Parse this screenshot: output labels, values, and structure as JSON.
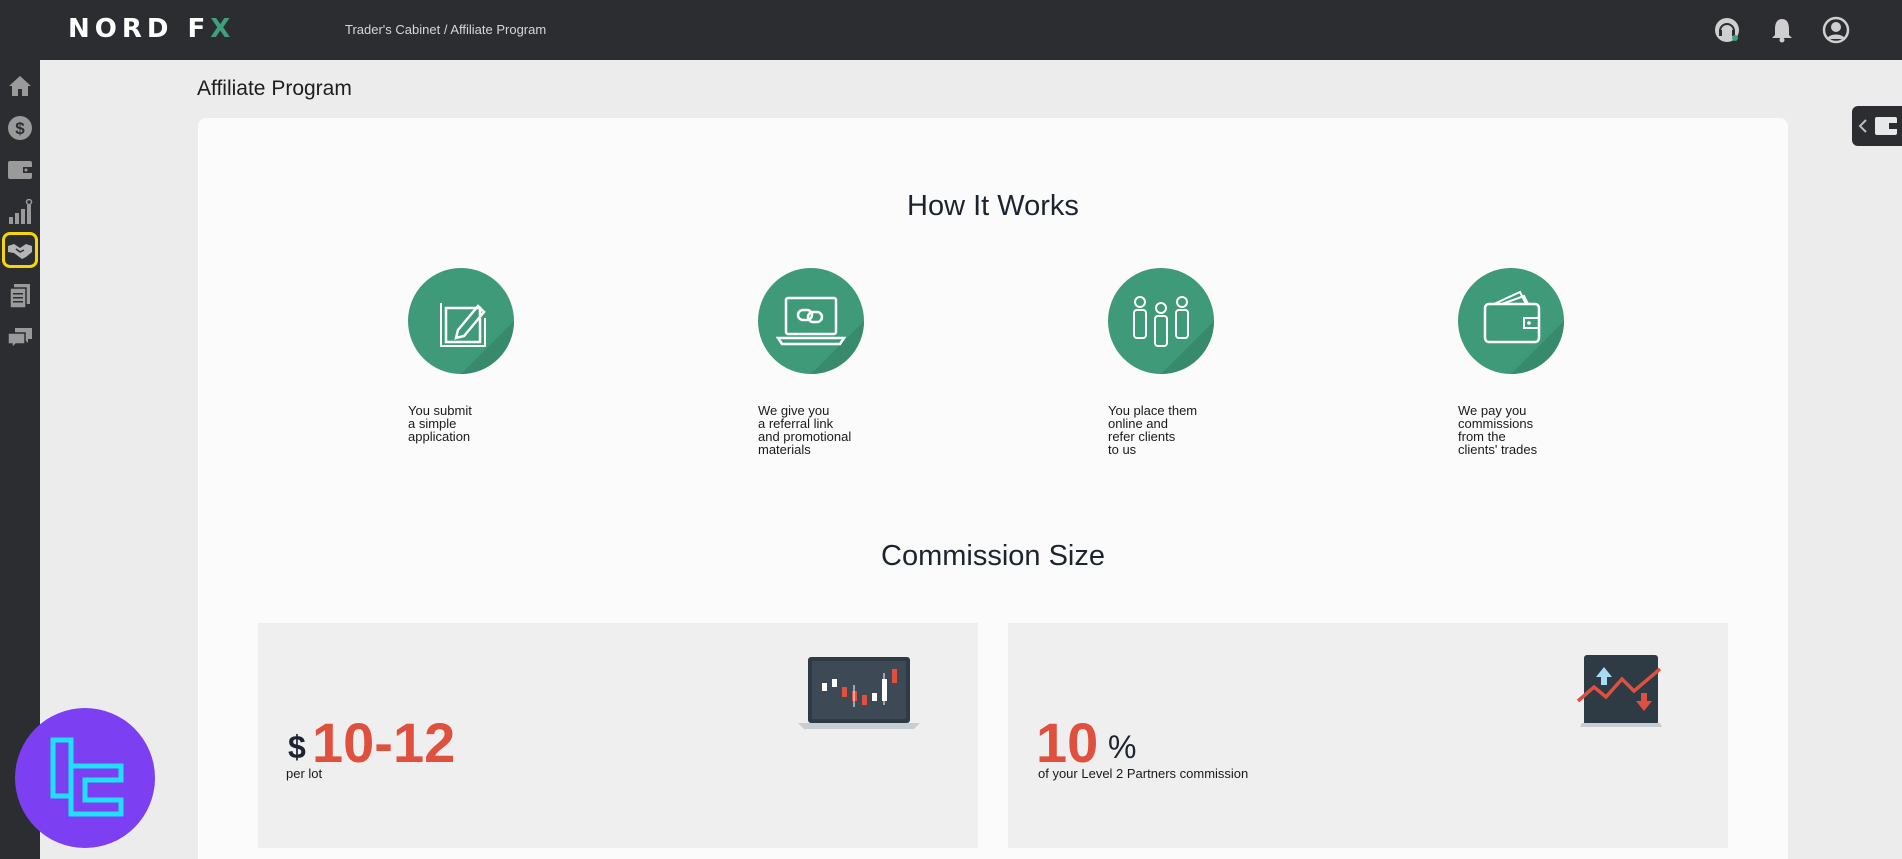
{
  "header": {
    "logo_left": "NORD F",
    "logo_x": "X",
    "breadcrumb": "Trader's Cabinet / Affiliate Program",
    "icons": [
      "support-icon",
      "bell-icon",
      "user-icon"
    ]
  },
  "sidebar": {
    "items": [
      {
        "icon": "home-icon"
      },
      {
        "icon": "dollar-icon"
      },
      {
        "icon": "wallet-icon"
      },
      {
        "icon": "analytics-icon"
      },
      {
        "icon": "handshake-icon",
        "active": true
      },
      {
        "icon": "documents-icon"
      },
      {
        "icon": "chat-icon"
      }
    ]
  },
  "page": {
    "title": "Affiliate Program"
  },
  "how_it_works": {
    "title": "How It Works",
    "steps": [
      {
        "icon": "edit-document-icon",
        "text": "You submit\na simple\napplication"
      },
      {
        "icon": "laptop-link-icon",
        "text": "We give you\na referral link\nand promotional\nmaterials"
      },
      {
        "icon": "people-icon",
        "text": "You place them\nonline and\nrefer clients\nto us"
      },
      {
        "icon": "wallet-icon",
        "text": "We pay you\ncommissions\nfrom the\nclients' trades"
      }
    ]
  },
  "commission": {
    "title": "Commission Size",
    "cards": [
      {
        "symbol": "$",
        "value": "10-12",
        "caption": "per lot",
        "icon": "laptop-chart-icon"
      },
      {
        "value": "10",
        "symbol": "%",
        "caption": "of your Level 2 Partners commission",
        "icon": "trend-chart-icon"
      }
    ]
  },
  "colors": {
    "accent_green": "#3e9a78",
    "commission_red": "#e0503e",
    "topbar": "#2b2d31",
    "highlight": "#f6d60a"
  }
}
